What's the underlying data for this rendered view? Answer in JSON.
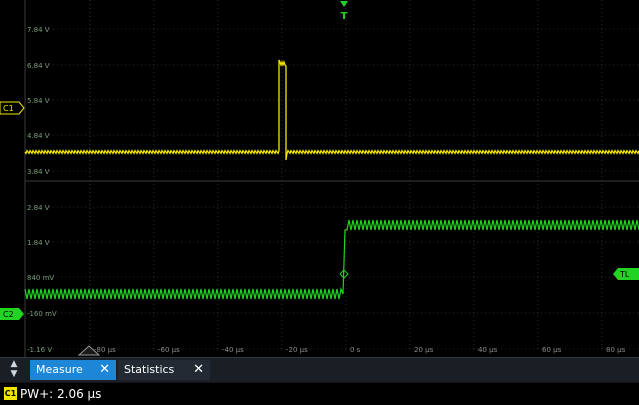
{
  "scope": {
    "voltage_labels": [
      "7.84 V",
      "6.84 V",
      "5.84 V",
      "4.84 V",
      "3.84 V",
      "2.84 V",
      "1.84 V",
      "840 mV",
      "-160 mV",
      "-1.16 V"
    ],
    "time_labels": [
      "-80 µs",
      "-60 µs",
      "-40 µs",
      "-20 µs",
      "0 s",
      "20 µs",
      "40 µs",
      "60 µs",
      "80 µs"
    ],
    "trigger_marker": "T",
    "trigger_level_label": "TL",
    "channels": [
      {
        "id": "C1",
        "label": "C1",
        "color": "#f2e600"
      },
      {
        "id": "C2",
        "label": "C2",
        "color": "#23d323"
      }
    ]
  },
  "bottom": {
    "tabs": [
      {
        "label": "Measure",
        "active": true
      },
      {
        "label": "Statistics",
        "active": false
      }
    ],
    "close_glyph": "✕",
    "result_channel": "C1",
    "result_text": "PW+: 2.06 µs"
  }
}
